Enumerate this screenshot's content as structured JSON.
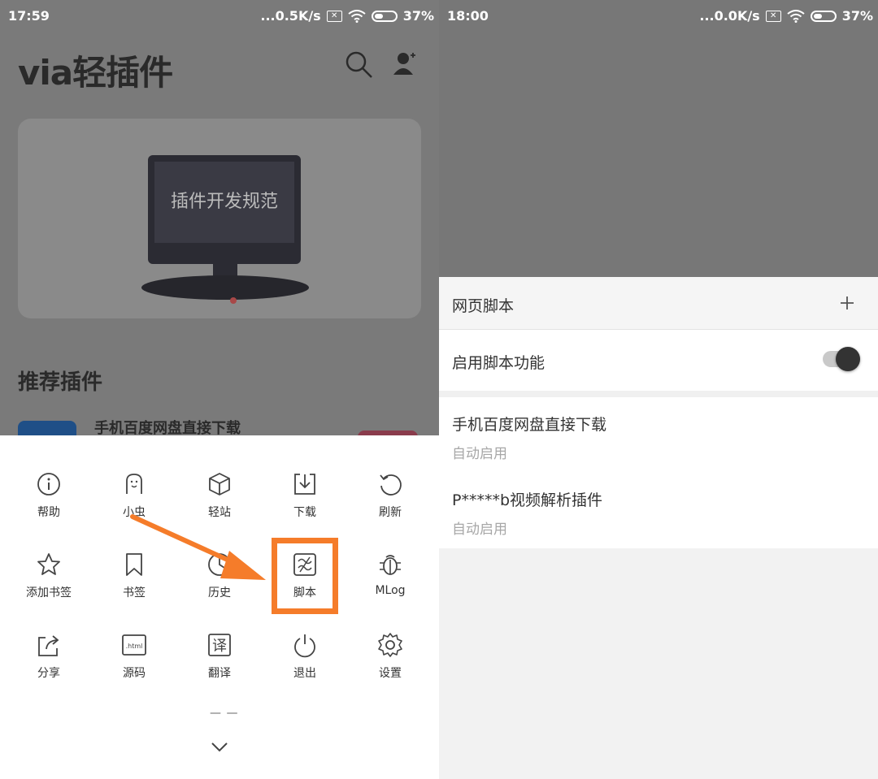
{
  "left": {
    "status": {
      "time": "17:59",
      "net": "...0.5K/s",
      "battery": "37%"
    },
    "app_title": "via轻插件",
    "banner_text": "插件开发规范",
    "section_title": "推荐插件",
    "plugin_name": "手机百度网盘直接下载",
    "menu": [
      {
        "label": "帮助",
        "icon": "info-icon"
      },
      {
        "label": "小虫",
        "icon": "ghost-icon"
      },
      {
        "label": "轻站",
        "icon": "cube-icon"
      },
      {
        "label": "下载",
        "icon": "download-icon"
      },
      {
        "label": "刷新",
        "icon": "refresh-icon"
      },
      {
        "label": "添加书签",
        "icon": "star-icon"
      },
      {
        "label": "书签",
        "icon": "bookmark-icon"
      },
      {
        "label": "历史",
        "icon": "clock-icon"
      },
      {
        "label": "脚本",
        "icon": "script-icon"
      },
      {
        "label": "MLog",
        "icon": "bug-icon"
      },
      {
        "label": "分享",
        "icon": "share-icon"
      },
      {
        "label": "源码",
        "icon": "html-icon"
      },
      {
        "label": "翻译",
        "icon": "translate-icon"
      },
      {
        "label": "退出",
        "icon": "power-icon"
      },
      {
        "label": "设置",
        "icon": "gear-icon"
      }
    ],
    "html_badge": ".html",
    "translate_char": "译",
    "dash_text": "— —",
    "accent_color": "#f57c2a"
  },
  "right": {
    "status": {
      "time": "18:00",
      "net": "...0.0K/s",
      "battery": "37%"
    },
    "header_title": "网页脚本",
    "toggle_label": "启用脚本功能",
    "toggle_on": true,
    "scripts": [
      {
        "name": "手机百度网盘直接下载",
        "status": "自动启用"
      },
      {
        "name": "P*****b视频解析插件",
        "status": "自动启用"
      }
    ]
  }
}
